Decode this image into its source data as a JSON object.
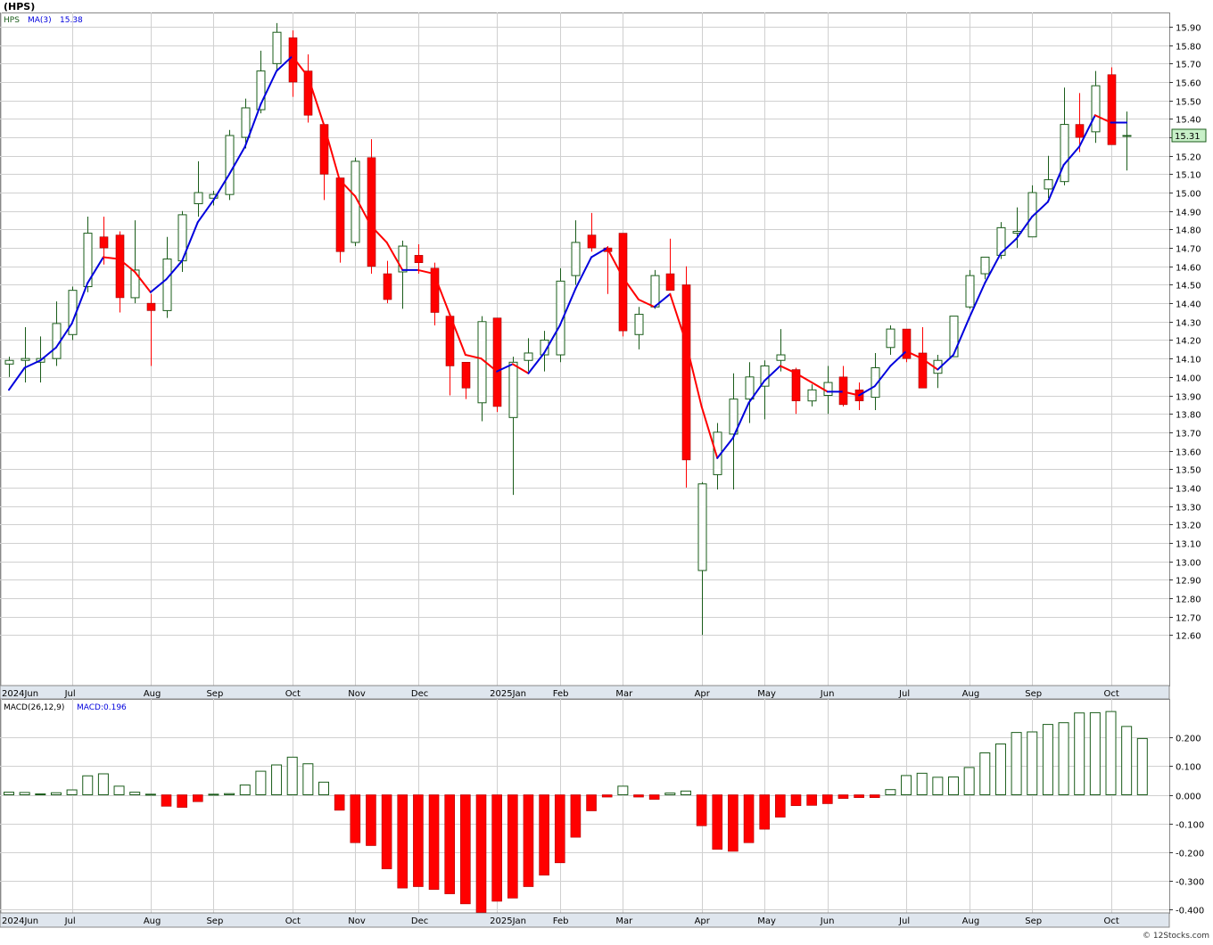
{
  "header": {
    "title": "(HPS)",
    "legend_symbol": "HPS",
    "ma_label": "MA(3)",
    "ma_value": "15.38",
    "macd_params": "MACD(26,12,9)",
    "macd_value": "MACD:0.196",
    "last_price_tag": "15.31",
    "credit": "© 12Stocks.com"
  },
  "colors": {
    "up_candle": "#1a5c1a",
    "down_candle": "#ff0000",
    "ma_up": "#0000dd",
    "ma_down": "#ff0000",
    "hist_up": "#1a5c1a",
    "hist_down": "#ff0000",
    "grid": "#d0d0d0",
    "axis_band": "#dfe6ee",
    "price_tag_bg": "#c8f0c8"
  },
  "chart_data": [
    {
      "type": "candlestick",
      "title": "(HPS)",
      "ylim": [
        12.56,
        15.95
      ],
      "y_ticks": [
        "15.90",
        "15.80",
        "15.70",
        "15.60",
        "15.50",
        "15.40",
        "15.30",
        "15.20",
        "15.10",
        "15.00",
        "14.90",
        "14.80",
        "14.70",
        "14.60",
        "14.50",
        "14.40",
        "14.30",
        "14.20",
        "14.10",
        "14.00",
        "13.90",
        "13.80",
        "13.70",
        "13.60",
        "13.50",
        "13.40",
        "13.30",
        "13.20",
        "13.10",
        "13.00",
        "12.90",
        "12.80",
        "12.70",
        "12.60"
      ],
      "x_month_labels": [
        {
          "label": "2024Jun",
          "week": -0.5
        },
        {
          "label": "Jul",
          "week": 4
        },
        {
          "label": "Aug",
          "week": 9
        },
        {
          "label": "Sep",
          "week": 13
        },
        {
          "label": "Oct",
          "week": 18
        },
        {
          "label": "Nov",
          "week": 22
        },
        {
          "label": "Dec",
          "week": 26
        },
        {
          "label": "2025Jan",
          "week": 31
        },
        {
          "label": "Feb",
          "week": 35
        },
        {
          "label": "Mar",
          "week": 39
        },
        {
          "label": "Apr",
          "week": 44
        },
        {
          "label": "May",
          "week": 48
        },
        {
          "label": "Jun",
          "week": 52
        },
        {
          "label": "Jul",
          "week": 57
        },
        {
          "label": "Aug",
          "week": 61
        },
        {
          "label": "Sep",
          "week": 65
        },
        {
          "label": "Oct",
          "week": 70
        }
      ],
      "candles": [
        {
          "o": 14.07,
          "h": 14.11,
          "l": 14.0,
          "c": 14.09
        },
        {
          "o": 14.09,
          "h": 14.27,
          "l": 13.97,
          "c": 14.1
        },
        {
          "o": 14.08,
          "h": 14.22,
          "l": 13.97,
          "c": 14.1
        },
        {
          "o": 14.1,
          "h": 14.41,
          "l": 14.06,
          "c": 14.29
        },
        {
          "o": 14.23,
          "h": 14.49,
          "l": 14.2,
          "c": 14.47
        },
        {
          "o": 14.49,
          "h": 14.87,
          "l": 14.46,
          "c": 14.78
        },
        {
          "o": 14.76,
          "h": 14.87,
          "l": 14.61,
          "c": 14.7
        },
        {
          "o": 14.77,
          "h": 14.79,
          "l": 14.35,
          "c": 14.43
        },
        {
          "o": 14.43,
          "h": 14.85,
          "l": 14.4,
          "c": 14.58
        },
        {
          "o": 14.4,
          "h": 14.45,
          "l": 14.06,
          "c": 14.36
        },
        {
          "o": 14.36,
          "h": 14.76,
          "l": 14.32,
          "c": 14.64
        },
        {
          "o": 14.63,
          "h": 14.9,
          "l": 14.57,
          "c": 14.88
        },
        {
          "o": 14.94,
          "h": 15.17,
          "l": 14.87,
          "c": 15.0
        },
        {
          "o": 14.97,
          "h": 15.01,
          "l": 14.93,
          "c": 14.99
        },
        {
          "o": 14.99,
          "h": 15.34,
          "l": 14.96,
          "c": 15.31
        },
        {
          "o": 15.3,
          "h": 15.51,
          "l": 15.24,
          "c": 15.46
        },
        {
          "o": 15.45,
          "h": 15.77,
          "l": 15.43,
          "c": 15.66
        },
        {
          "o": 15.7,
          "h": 15.92,
          "l": 15.66,
          "c": 15.87
        },
        {
          "o": 15.84,
          "h": 15.88,
          "l": 15.52,
          "c": 15.6
        },
        {
          "o": 15.66,
          "h": 15.75,
          "l": 15.38,
          "c": 15.42
        },
        {
          "o": 15.37,
          "h": 15.37,
          "l": 14.96,
          "c": 15.1
        },
        {
          "o": 15.08,
          "h": 15.08,
          "l": 14.62,
          "c": 14.68
        },
        {
          "o": 14.73,
          "h": 15.19,
          "l": 14.71,
          "c": 15.17
        },
        {
          "o": 15.19,
          "h": 15.29,
          "l": 14.56,
          "c": 14.6
        },
        {
          "o": 14.56,
          "h": 14.63,
          "l": 14.4,
          "c": 14.42
        },
        {
          "o": 14.57,
          "h": 14.74,
          "l": 14.37,
          "c": 14.71
        },
        {
          "o": 14.66,
          "h": 14.72,
          "l": 14.56,
          "c": 14.62
        },
        {
          "o": 14.59,
          "h": 14.62,
          "l": 14.28,
          "c": 14.35
        },
        {
          "o": 14.33,
          "h": 14.33,
          "l": 13.9,
          "c": 14.06
        },
        {
          "o": 14.08,
          "h": 14.08,
          "l": 13.88,
          "c": 13.94
        },
        {
          "o": 13.86,
          "h": 14.33,
          "l": 13.76,
          "c": 14.3
        },
        {
          "o": 14.32,
          "h": 14.32,
          "l": 13.81,
          "c": 13.84
        },
        {
          "o": 13.78,
          "h": 14.11,
          "l": 13.36,
          "c": 14.08
        },
        {
          "o": 14.09,
          "h": 14.21,
          "l": 14.03,
          "c": 14.13
        },
        {
          "o": 14.12,
          "h": 14.25,
          "l": 14.03,
          "c": 14.2
        },
        {
          "o": 14.12,
          "h": 14.59,
          "l": 14.08,
          "c": 14.52
        },
        {
          "o": 14.55,
          "h": 14.85,
          "l": 14.5,
          "c": 14.73
        },
        {
          "o": 14.77,
          "h": 14.89,
          "l": 14.68,
          "c": 14.7
        },
        {
          "o": 14.7,
          "h": 14.71,
          "l": 14.45,
          "c": 14.68
        },
        {
          "o": 14.78,
          "h": 14.78,
          "l": 14.22,
          "c": 14.25
        },
        {
          "o": 14.23,
          "h": 14.38,
          "l": 14.15,
          "c": 14.34
        },
        {
          "o": 14.38,
          "h": 14.58,
          "l": 14.37,
          "c": 14.55
        },
        {
          "o": 14.56,
          "h": 14.75,
          "l": 14.48,
          "c": 14.47
        },
        {
          "o": 14.5,
          "h": 14.6,
          "l": 13.4,
          "c": 13.55
        },
        {
          "o": 12.95,
          "h": 13.43,
          "l": 12.6,
          "c": 13.42
        },
        {
          "o": 13.47,
          "h": 13.75,
          "l": 13.39,
          "c": 13.7
        },
        {
          "o": 13.69,
          "h": 14.02,
          "l": 13.39,
          "c": 13.88
        },
        {
          "o": 13.88,
          "h": 14.08,
          "l": 13.75,
          "c": 14.0
        },
        {
          "o": 13.95,
          "h": 14.09,
          "l": 13.77,
          "c": 14.06
        },
        {
          "o": 14.09,
          "h": 14.26,
          "l": 14.03,
          "c": 14.12
        },
        {
          "o": 14.04,
          "h": 14.05,
          "l": 13.8,
          "c": 13.87
        },
        {
          "o": 13.87,
          "h": 13.96,
          "l": 13.84,
          "c": 13.93
        },
        {
          "o": 13.9,
          "h": 14.06,
          "l": 13.8,
          "c": 13.97
        },
        {
          "o": 14.0,
          "h": 14.06,
          "l": 13.84,
          "c": 13.85
        },
        {
          "o": 13.93,
          "h": 13.97,
          "l": 13.82,
          "c": 13.87
        },
        {
          "o": 13.89,
          "h": 14.13,
          "l": 13.82,
          "c": 14.05
        },
        {
          "o": 14.16,
          "h": 14.28,
          "l": 14.12,
          "c": 14.26
        },
        {
          "o": 14.26,
          "h": 14.26,
          "l": 14.08,
          "c": 14.1
        },
        {
          "o": 14.13,
          "h": 14.27,
          "l": 13.95,
          "c": 13.94
        },
        {
          "o": 14.02,
          "h": 14.12,
          "l": 13.94,
          "c": 14.09
        },
        {
          "o": 14.11,
          "h": 14.33,
          "l": 14.11,
          "c": 14.33
        },
        {
          "o": 14.38,
          "h": 14.58,
          "l": 14.37,
          "c": 14.55
        },
        {
          "o": 14.56,
          "h": 14.62,
          "l": 14.53,
          "c": 14.65
        },
        {
          "o": 14.66,
          "h": 14.84,
          "l": 14.64,
          "c": 14.81
        },
        {
          "o": 14.78,
          "h": 14.92,
          "l": 14.7,
          "c": 14.79
        },
        {
          "o": 14.76,
          "h": 15.04,
          "l": 14.76,
          "c": 15.0
        },
        {
          "o": 15.02,
          "h": 15.2,
          "l": 14.97,
          "c": 15.07
        },
        {
          "o": 15.06,
          "h": 15.57,
          "l": 15.04,
          "c": 15.37
        },
        {
          "o": 15.37,
          "h": 15.54,
          "l": 15.22,
          "c": 15.3
        },
        {
          "o": 15.33,
          "h": 15.66,
          "l": 15.27,
          "c": 15.58
        },
        {
          "o": 15.64,
          "h": 15.68,
          "l": 15.27,
          "c": 15.26
        },
        {
          "o": 15.31,
          "h": 15.44,
          "l": 15.12,
          "c": 15.31
        }
      ],
      "ma3": [
        13.93,
        14.05,
        14.09,
        14.16,
        14.29,
        14.51,
        14.65,
        14.64,
        14.57,
        14.46,
        14.53,
        14.63,
        14.84,
        14.96,
        15.1,
        15.25,
        15.48,
        15.66,
        15.74,
        15.63,
        15.37,
        15.07,
        14.98,
        14.82,
        14.73,
        14.58,
        14.58,
        14.56,
        14.34,
        14.12,
        14.1,
        14.03,
        14.07,
        14.02,
        14.13,
        14.28,
        14.48,
        14.65,
        14.7,
        14.54,
        14.42,
        14.38,
        14.45,
        14.19,
        13.84,
        13.56,
        13.67,
        13.86,
        13.98,
        14.06,
        14.02,
        13.97,
        13.92,
        13.92,
        13.9,
        13.95,
        14.06,
        14.14,
        14.1,
        14.04,
        14.12,
        14.32,
        14.51,
        14.67,
        14.75,
        14.87,
        14.95,
        15.15,
        15.25,
        15.42,
        15.38,
        15.38
      ],
      "last_price": 15.31
    },
    {
      "type": "bar",
      "title": "MACD(26,12,9)",
      "ylim": [
        -0.41,
        0.31
      ],
      "y_ticks": [
        "0.200",
        "0.100",
        "0.000",
        "-0.100",
        "-0.200",
        "-0.300",
        "-0.400"
      ],
      "values": [
        0.009,
        0.008,
        0.003,
        0.007,
        0.017,
        0.066,
        0.073,
        0.03,
        0.009,
        0.002,
        -0.04,
        -0.044,
        -0.024,
        0.002,
        0.004,
        0.034,
        0.082,
        0.104,
        0.131,
        0.108,
        0.044,
        -0.054,
        -0.167,
        -0.177,
        -0.258,
        -0.325,
        -0.32,
        -0.33,
        -0.345,
        -0.38,
        -0.41,
        -0.371,
        -0.36,
        -0.32,
        -0.28,
        -0.237,
        -0.148,
        -0.056,
        -0.008,
        0.03,
        -0.008,
        -0.016,
        0.006,
        0.013,
        -0.108,
        -0.19,
        -0.197,
        -0.167,
        -0.12,
        -0.078,
        -0.038,
        -0.037,
        -0.031,
        -0.013,
        -0.01,
        -0.01,
        0.018,
        0.067,
        0.075,
        0.061,
        0.062,
        0.095,
        0.146,
        0.177,
        0.217,
        0.219,
        0.245,
        0.251,
        0.285,
        0.286,
        0.29,
        0.238,
        0.196
      ],
      "value_label": "MACD:0.196"
    }
  ],
  "footer": {
    "credit": "© 12Stocks.com"
  }
}
